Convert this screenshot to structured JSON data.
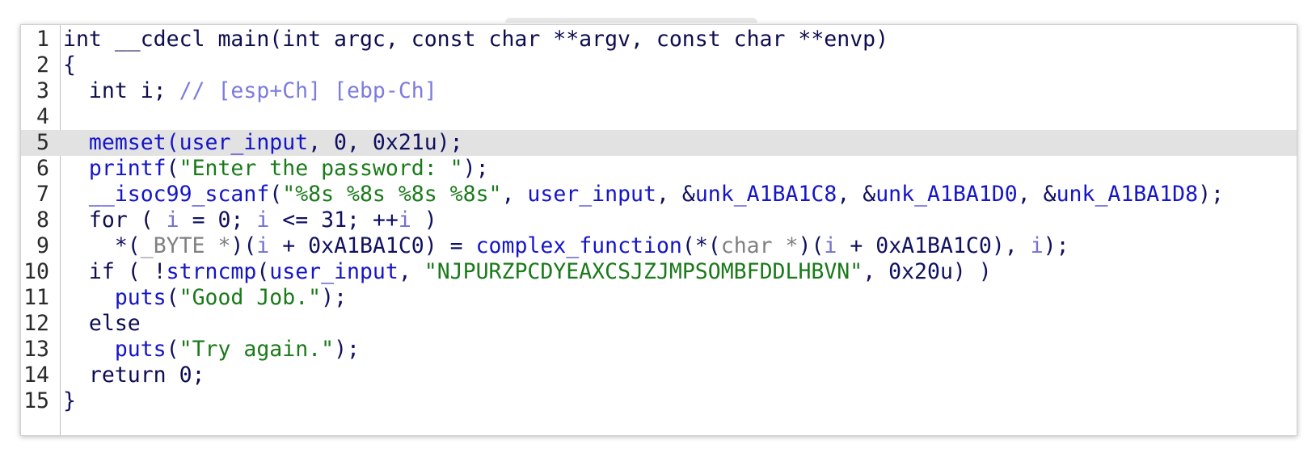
{
  "editor": {
    "lines": [
      {
        "num": "1",
        "current": false,
        "tokens": [
          {
            "t": "int __cdecl main(int argc, const char **argv, const char **envp)",
            "c": "kw"
          }
        ]
      },
      {
        "num": "2",
        "current": false,
        "tokens": [
          {
            "t": "{",
            "c": "pl"
          }
        ]
      },
      {
        "num": "3",
        "current": false,
        "tokens": [
          {
            "t": "  int i; ",
            "c": "kw"
          },
          {
            "t": "// [esp+Ch] [ebp-Ch]",
            "c": "cmt"
          }
        ]
      },
      {
        "num": "4",
        "current": false,
        "tokens": []
      },
      {
        "num": "5",
        "current": true,
        "tokens": [
          {
            "t": "  memset(user_input",
            "c": "fn"
          },
          {
            "t": ", 0, 0x21u);",
            "c": "pl"
          }
        ]
      },
      {
        "num": "6",
        "current": false,
        "tokens": [
          {
            "t": "  printf",
            "c": "fn"
          },
          {
            "t": "(",
            "c": "pl"
          },
          {
            "t": "\"Enter the password: \"",
            "c": "str"
          },
          {
            "t": ");",
            "c": "pl"
          }
        ]
      },
      {
        "num": "7",
        "current": false,
        "tokens": [
          {
            "t": "  __isoc99_scanf",
            "c": "fn"
          },
          {
            "t": "(",
            "c": "pl"
          },
          {
            "t": "\"%8s %8s %8s %8s\"",
            "c": "str"
          },
          {
            "t": ", ",
            "c": "pl"
          },
          {
            "t": "user_input",
            "c": "fn"
          },
          {
            "t": ", &",
            "c": "pl"
          },
          {
            "t": "unk_A1BA1C8",
            "c": "fn"
          },
          {
            "t": ", &",
            "c": "pl"
          },
          {
            "t": "unk_A1BA1D0",
            "c": "fn"
          },
          {
            "t": ", &",
            "c": "pl"
          },
          {
            "t": "unk_A1BA1D8",
            "c": "fn"
          },
          {
            "t": ");",
            "c": "pl"
          }
        ]
      },
      {
        "num": "8",
        "current": false,
        "tokens": [
          {
            "t": "  for ( ",
            "c": "kw"
          },
          {
            "t": "i",
            "c": "var"
          },
          {
            "t": " = 0; ",
            "c": "pl"
          },
          {
            "t": "i",
            "c": "var"
          },
          {
            "t": " <= 31; ++",
            "c": "pl"
          },
          {
            "t": "i",
            "c": "var"
          },
          {
            "t": " )",
            "c": "pl"
          }
        ]
      },
      {
        "num": "9",
        "current": false,
        "tokens": [
          {
            "t": "    *(",
            "c": "pl"
          },
          {
            "t": "_BYTE *",
            "c": "gray"
          },
          {
            "t": ")(",
            "c": "pl"
          },
          {
            "t": "i",
            "c": "var"
          },
          {
            "t": " + 0xA1BA1C0) = ",
            "c": "pl"
          },
          {
            "t": "complex_function",
            "c": "fn"
          },
          {
            "t": "(*(",
            "c": "pl"
          },
          {
            "t": "char *",
            "c": "gray"
          },
          {
            "t": ")(",
            "c": "pl"
          },
          {
            "t": "i",
            "c": "var"
          },
          {
            "t": " + 0xA1BA1C0), ",
            "c": "pl"
          },
          {
            "t": "i",
            "c": "var"
          },
          {
            "t": ");",
            "c": "pl"
          }
        ]
      },
      {
        "num": "10",
        "current": false,
        "tokens": [
          {
            "t": "  if ( !",
            "c": "kw"
          },
          {
            "t": "strncmp",
            "c": "fn"
          },
          {
            "t": "(",
            "c": "pl"
          },
          {
            "t": "user_input",
            "c": "fn"
          },
          {
            "t": ", ",
            "c": "pl"
          },
          {
            "t": "\"NJPURZPCDYEAXCSJZJMPSOMBFDDLHBVN\"",
            "c": "str"
          },
          {
            "t": ", 0x20u) )",
            "c": "pl"
          }
        ]
      },
      {
        "num": "11",
        "current": false,
        "tokens": [
          {
            "t": "    puts",
            "c": "fn"
          },
          {
            "t": "(",
            "c": "pl"
          },
          {
            "t": "\"Good Job.\"",
            "c": "str"
          },
          {
            "t": ");",
            "c": "pl"
          }
        ]
      },
      {
        "num": "12",
        "current": false,
        "tokens": [
          {
            "t": "  else",
            "c": "kw"
          }
        ]
      },
      {
        "num": "13",
        "current": false,
        "tokens": [
          {
            "t": "    puts",
            "c": "fn"
          },
          {
            "t": "(",
            "c": "pl"
          },
          {
            "t": "\"Try again.\"",
            "c": "str"
          },
          {
            "t": ");",
            "c": "pl"
          }
        ]
      },
      {
        "num": "14",
        "current": false,
        "tokens": [
          {
            "t": "  return 0;",
            "c": "kw"
          }
        ]
      },
      {
        "num": "15",
        "current": false,
        "tokens": [
          {
            "t": "}",
            "c": "pl"
          }
        ]
      }
    ]
  }
}
